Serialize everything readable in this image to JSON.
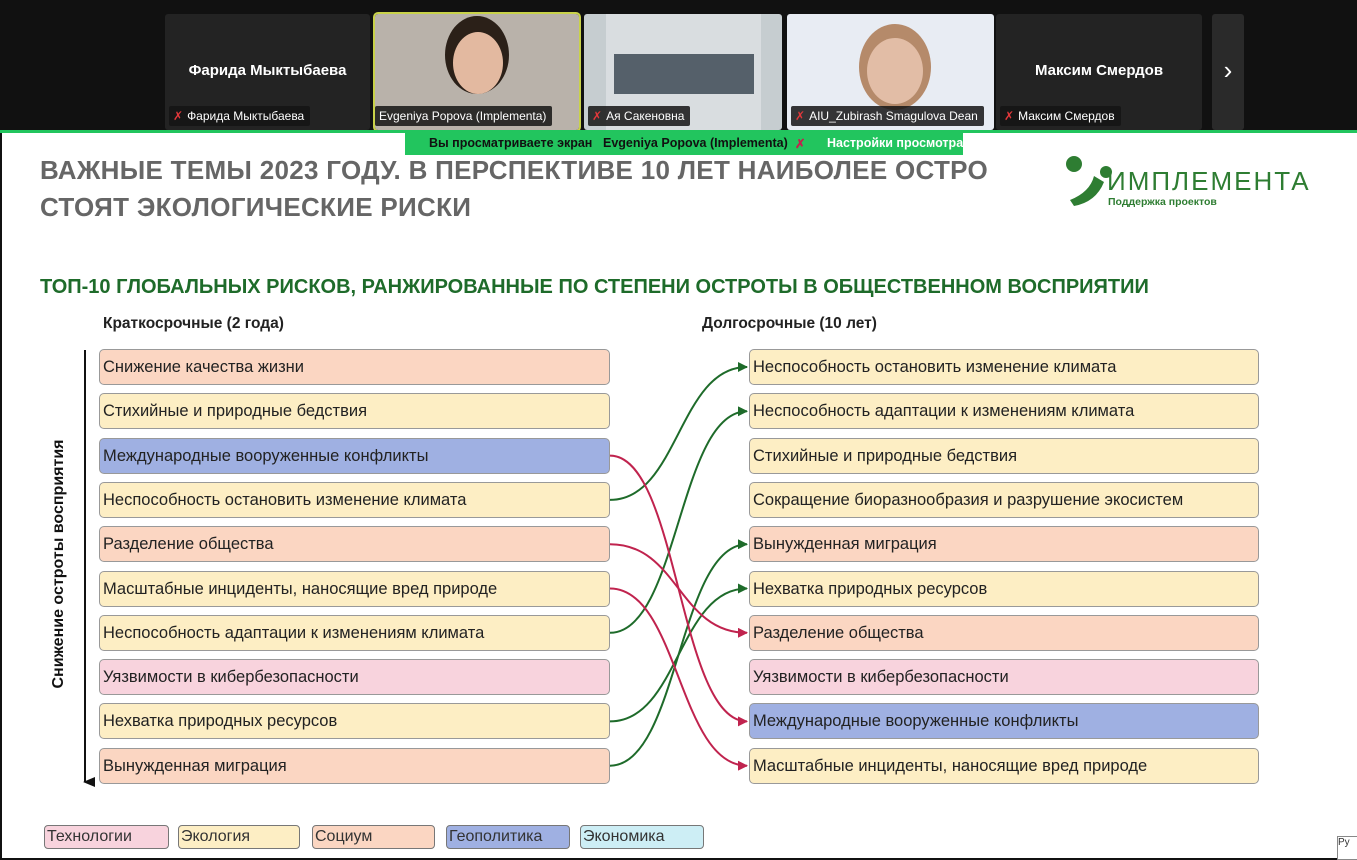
{
  "participants": {
    "tile1": {
      "name": "Фарида Мыктыбаева",
      "label": "Фарида Мыктыбаева"
    },
    "tile2": {
      "label": "Evgeniya Popova (Implementa)"
    },
    "tile3": {
      "label": "Ая Сакеновна"
    },
    "tile4": {
      "label": "AIU_Zubirash Smagulova Dean"
    },
    "tile5": {
      "name": "Максим Смердов",
      "label": "Максим Смердов"
    }
  },
  "share_bar": {
    "viewing": "Вы просматриваете экран",
    "presenter": "Evgeniya Popova (Implementa)",
    "settings": "Настройки просмотра"
  },
  "slide": {
    "title_line1": "ВАЖНЫЕ ТЕМЫ 2023 ГОДУ. В ПЕРСПЕКТИВЕ 10 ЛЕТ НАИБОЛЕЕ ОСТРО",
    "title_line2": "СТОЯТ ЭКОЛОГИЧЕСКИЕ РИСКИ",
    "logo": {
      "name": "ИМПЛЕМЕНТА",
      "tagline": "Поддержка проектов"
    },
    "subtitle": "ТОП-10 ГЛОБАЛЬНЫХ РИСКОВ, РАНЖИРОВАННЫЕ ПО СТЕПЕНИ ОСТРОТЫ В ОБЩЕСТВЕННОМ ВОСПРИЯТИИ",
    "short_term_header": "Краткосрочные (2 года)",
    "long_term_header": "Долгосрочные (10 лет)",
    "axis_label": "Снижение остроты восприятия",
    "short_term": [
      {
        "label": "Снижение качества жизни",
        "category": "social"
      },
      {
        "label": "Стихийные и природные бедствия",
        "category": "ecology"
      },
      {
        "label": "Международные вооруженные конфликты",
        "category": "geopolitics"
      },
      {
        "label": "Неспособность остановить изменение климата",
        "category": "ecology"
      },
      {
        "label": "Разделение общества",
        "category": "social"
      },
      {
        "label": "Масштабные инциденты, наносящие вред природе",
        "category": "ecology"
      },
      {
        "label": "Неспособность адаптации к изменениям климата",
        "category": "ecology"
      },
      {
        "label": "Уязвимости в кибербезопасности",
        "category": "technology"
      },
      {
        "label": "Нехватка природных ресурсов",
        "category": "ecology"
      },
      {
        "label": "Вынужденная миграция",
        "category": "social"
      }
    ],
    "long_term": [
      {
        "label": "Неспособность остановить изменение климата",
        "category": "ecology"
      },
      {
        "label": "Неспособность адаптации к изменениям климата",
        "category": "ecology"
      },
      {
        "label": "Стихийные и природные бедствия",
        "category": "ecology"
      },
      {
        "label": "Сокращение биоразнообразия и разрушение экосистем",
        "category": "ecology"
      },
      {
        "label": "Вынужденная миграция",
        "category": "social"
      },
      {
        "label": "Нехватка природных ресурсов",
        "category": "ecology"
      },
      {
        "label": "Разделение общества",
        "category": "social"
      },
      {
        "label": "Уязвимости в кибербезопасности",
        "category": "technology"
      },
      {
        "label": "Международные вооруженные конфликты",
        "category": "geopolitics"
      },
      {
        "label": "Масштабные инциденты, наносящие вред природе",
        "category": "ecology"
      }
    ],
    "arrows_up_green": [
      [
        3,
        0
      ],
      [
        6,
        1
      ],
      [
        9,
        4
      ],
      [
        8,
        5
      ]
    ],
    "arrows_down_red": [
      [
        2,
        8
      ],
      [
        4,
        6
      ],
      [
        5,
        9
      ]
    ],
    "legend": [
      {
        "label": "Технологии",
        "category": "technology"
      },
      {
        "label": "Экология",
        "category": "ecology"
      },
      {
        "label": "Социум",
        "category": "social"
      },
      {
        "label": "Геополитика",
        "category": "geopolitics"
      },
      {
        "label": "Экономика",
        "category": "economy"
      }
    ],
    "category_colors": {
      "technology": "#f8d3dd",
      "ecology": "#fdeec4",
      "social": "#fbd6c2",
      "geopolitics": "#9fb0e2",
      "economy": "#cdeef5"
    },
    "arrow_colors": {
      "up": "#1e6b2a",
      "down": "#c0234e"
    }
  },
  "system": {
    "lang": "Ру"
  }
}
